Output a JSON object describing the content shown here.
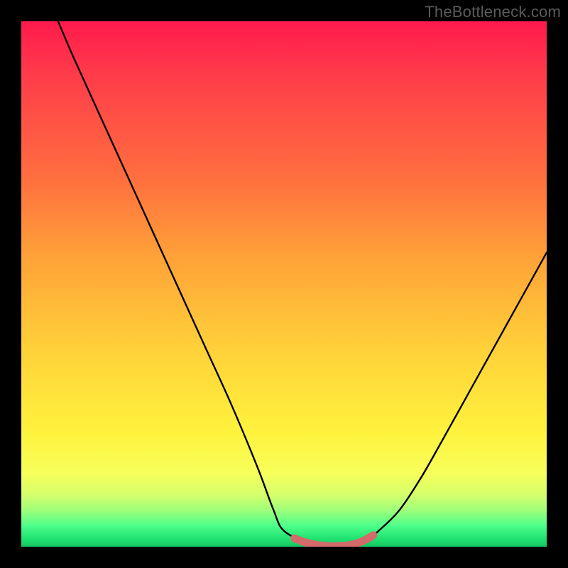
{
  "watermark": "TheBottleneck.com",
  "chart_data": {
    "type": "line",
    "title": "",
    "xlabel": "",
    "ylabel": "",
    "xlim": [
      0,
      100
    ],
    "ylim": [
      0,
      100
    ],
    "grid": false,
    "legend": false,
    "background_gradient": {
      "direction": "vertical",
      "stops": [
        {
          "t": 0.0,
          "color": "#ff1a4d"
        },
        {
          "t": 0.3,
          "color": "#ff6f3f"
        },
        {
          "t": 0.62,
          "color": "#ffd039"
        },
        {
          "t": 0.86,
          "color": "#f7ff5a"
        },
        {
          "t": 0.96,
          "color": "#4dff8a"
        },
        {
          "t": 1.0,
          "color": "#15c562"
        }
      ]
    },
    "series": [
      {
        "name": "curve",
        "color": "#000000",
        "x": [
          7,
          10,
          15,
          20,
          25,
          30,
          35,
          40,
          45,
          48,
          50,
          55,
          58,
          62,
          65,
          68,
          72,
          76,
          80,
          85,
          90,
          95,
          100
        ],
        "y": [
          100,
          93,
          82,
          71,
          60,
          49,
          38,
          27,
          15,
          7,
          3,
          0.5,
          0,
          0,
          0.5,
          3,
          7,
          13,
          20,
          29,
          38,
          47,
          56
        ]
      },
      {
        "name": "bottom-marker",
        "color": "#d46a6a",
        "style": "dots",
        "x": [
          52,
          53.5,
          55,
          56.5,
          58,
          59.5,
          61,
          62.5,
          64,
          65.5,
          67
        ],
        "y": [
          1.6,
          1.0,
          0.6,
          0.3,
          0.15,
          0.1,
          0.15,
          0.3,
          0.7,
          1.3,
          2.2
        ]
      }
    ],
    "annotations": []
  }
}
